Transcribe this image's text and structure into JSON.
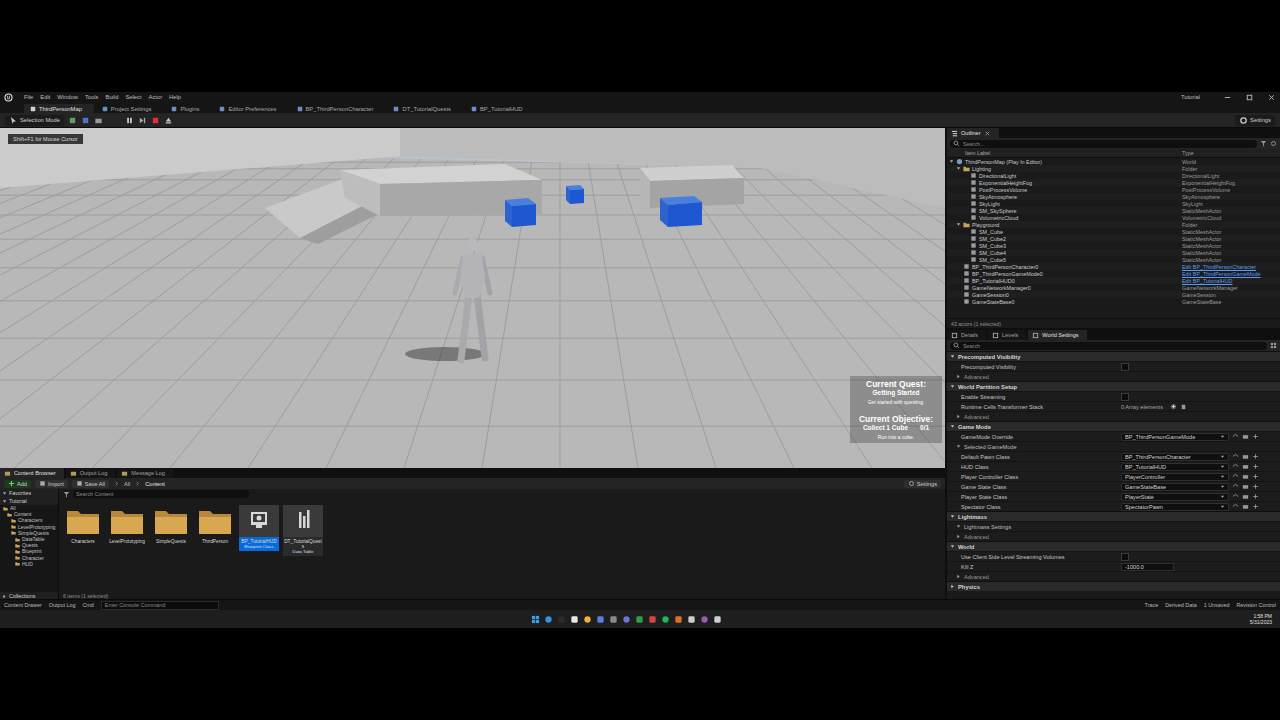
{
  "window": {
    "title": "Tutorial",
    "menu": [
      "File",
      "Edit",
      "Window",
      "Tools",
      "Build",
      "Select",
      "Actor",
      "Help"
    ]
  },
  "tabs": [
    {
      "label": "ThirdPersonMap",
      "selected": true
    },
    {
      "label": "Project Settings",
      "selected": false
    },
    {
      "label": "Plugins",
      "selected": false
    },
    {
      "label": "Editor Preferences",
      "selected": false
    },
    {
      "label": "BP_ThirdPersonCharacter",
      "selected": false
    },
    {
      "label": "DT_TutorialQuests",
      "selected": false
    },
    {
      "label": "BP_TutorialHUD",
      "selected": false
    }
  ],
  "toolbar": {
    "mode": "Selection Mode",
    "settings": "Settings",
    "play_session": {
      "running": true
    }
  },
  "viewport": {
    "hint": "Shift+F1 for Mouse Cursor",
    "quest": {
      "heading": "Current Quest:",
      "name": "Getting Started",
      "description": "Get started with questing."
    },
    "objective": {
      "heading": "Current Objective:",
      "name": "Collect 1 Cube",
      "progress": "0/1",
      "description": "Run into a cube."
    }
  },
  "outliner": {
    "title": "Outliner",
    "search": {
      "placeholder": "Search..."
    },
    "columns": [
      "Item Label",
      "Type"
    ],
    "tree": [
      {
        "label": "ThirdPersonMap (Play In Editor)",
        "type": "World",
        "kind": "world",
        "expanded": true,
        "children": [
          {
            "label": "Lighting",
            "type": "Folder",
            "kind": "folder",
            "expanded": true,
            "children": [
              {
                "label": "DirectionalLight",
                "type": "DirectionalLight",
                "kind": "actor",
                "link": false
              },
              {
                "label": "ExponentialHeightFog",
                "type": "ExponentialHeightFog",
                "kind": "actor",
                "link": false
              },
              {
                "label": "PostProcessVolume",
                "type": "PostProcessVolume",
                "kind": "actor",
                "link": false
              },
              {
                "label": "SkyAtmosphere",
                "type": "SkyAtmosphere",
                "kind": "actor",
                "link": false
              },
              {
                "label": "SkyLight",
                "type": "SkyLight",
                "kind": "actor",
                "link": false
              },
              {
                "label": "SM_SkySphere",
                "type": "StaticMeshActor",
                "kind": "actor",
                "link": false
              },
              {
                "label": "VolumetricCloud",
                "type": "VolumetricCloud",
                "kind": "actor",
                "link": false
              }
            ]
          },
          {
            "label": "Playground",
            "type": "Folder",
            "kind": "folder",
            "expanded": true,
            "children": [
              {
                "label": "SM_Cube",
                "type": "StaticMeshActor",
                "kind": "actor",
                "link": false
              },
              {
                "label": "SM_Cube2",
                "type": "StaticMeshActor",
                "kind": "actor",
                "link": false
              },
              {
                "label": "SM_Cube3",
                "type": "StaticMeshActor",
                "kind": "actor",
                "link": false
              },
              {
                "label": "SM_Cube4",
                "type": "StaticMeshActor",
                "kind": "actor",
                "link": false
              },
              {
                "label": "SM_Cube5",
                "type": "StaticMeshActor",
                "kind": "actor",
                "link": false
              }
            ]
          },
          {
            "label": "BP_ThirdPersonCharacter0",
            "type": "Edit BP_ThirdPersonCharacter",
            "kind": "actor",
            "link": true
          },
          {
            "label": "BP_ThirdPersonGameMode0",
            "type": "Edit BP_ThirdPersonGameMode",
            "kind": "actor",
            "link": true
          },
          {
            "label": "BP_TutorialHUD0",
            "type": "Edit BP_TutorialHUD",
            "kind": "actor",
            "link": true
          },
          {
            "label": "GameNetworkManager0",
            "type": "GameNetworkManager",
            "kind": "actor",
            "link": false
          },
          {
            "label": "GameSession0",
            "type": "GameSession",
            "kind": "actor",
            "link": false
          },
          {
            "label": "GameStateBase0",
            "type": "GameStateBase",
            "kind": "actor",
            "link": false
          }
        ]
      }
    ],
    "footer": "43 actors (1 selected)"
  },
  "details": {
    "tabs": [
      {
        "label": "Details",
        "selected": false
      },
      {
        "label": "Levels",
        "selected": false
      },
      {
        "label": "World Settings",
        "selected": true
      }
    ],
    "search": {
      "placeholder": "Search"
    },
    "sections": [
      {
        "title": "Precomputed Visibility",
        "expanded": true,
        "rows": [
          {
            "kind": "checkbox",
            "label": "Precomputed Visibility",
            "checked": false
          },
          {
            "kind": "advanced",
            "label": "Advanced"
          }
        ]
      },
      {
        "title": "World Partition Setup",
        "expanded": true,
        "rows": [
          {
            "kind": "checkbox",
            "label": "Enable Streaming",
            "checked": false
          },
          {
            "kind": "array",
            "label": "Runtime Cells Transformer Stack",
            "value": "0 Array elements"
          },
          {
            "kind": "advanced",
            "label": "Advanced"
          }
        ]
      },
      {
        "title": "Game Mode",
        "expanded": true,
        "rows": [
          {
            "kind": "dropdown",
            "label": "GameMode Override",
            "value": "BP_ThirdPersonGameMode"
          },
          {
            "kind": "group",
            "label": "Selected GameMode"
          },
          {
            "kind": "dropdown",
            "label": "Default Pawn Class",
            "value": "BP_ThirdPersonCharacter"
          },
          {
            "kind": "dropdown",
            "label": "HUD Class",
            "value": "BP_TutorialHUD"
          },
          {
            "kind": "dropdown",
            "label": "Player Controller Class",
            "value": "PlayerController"
          },
          {
            "kind": "dropdown",
            "label": "Game State Class",
            "value": "GameStateBase"
          },
          {
            "kind": "dropdown",
            "label": "Player State Class",
            "value": "PlayerState"
          },
          {
            "kind": "dropdown",
            "label": "Spectator Class",
            "value": "SpectatorPawn"
          }
        ]
      },
      {
        "title": "Lightmass",
        "expanded": true,
        "rows": [
          {
            "kind": "group",
            "label": "Lightmass Settings"
          },
          {
            "kind": "advanced",
            "label": "Advanced"
          }
        ]
      },
      {
        "title": "World",
        "expanded": true,
        "rows": [
          {
            "kind": "checkbox",
            "label": "Use Client Side Level Streaming Volumes",
            "checked": false
          },
          {
            "kind": "text",
            "label": "Kill Z",
            "value": "-1000.0"
          },
          {
            "kind": "advanced",
            "label": "Advanced"
          }
        ]
      },
      {
        "title": "Physics",
        "expanded": false,
        "rows": []
      }
    ]
  },
  "content_browser": {
    "tabs": [
      {
        "label": "Content Browser",
        "selected": true
      },
      {
        "label": "Output Log",
        "selected": false
      },
      {
        "label": "Message Log",
        "selected": false
      }
    ],
    "buttons": [
      "Add",
      "Import",
      "Save All"
    ],
    "path": [
      "All",
      "Content"
    ],
    "settings": "Settings",
    "search": {
      "placeholder": "Search Content"
    },
    "sidebar": {
      "sections": [
        "Favorites",
        "Tutorial"
      ],
      "tree": [
        {
          "label": "All",
          "depth": 0
        },
        {
          "label": "Content",
          "depth": 1
        },
        {
          "label": "Characters",
          "depth": 2
        },
        {
          "label": "LevelPrototyping",
          "depth": 2
        },
        {
          "label": "SimpleQuests",
          "depth": 2
        },
        {
          "label": "DataTable",
          "depth": 3
        },
        {
          "label": "Quests",
          "depth": 3
        },
        {
          "label": "Blueprint",
          "depth": 3
        },
        {
          "label": "Character",
          "depth": 3
        },
        {
          "label": "HUD",
          "depth": 3
        }
      ],
      "collections": "Collections"
    },
    "items": [
      {
        "name": "Characters",
        "kind": "folder",
        "selected": false,
        "subtitle": ""
      },
      {
        "name": "LevelPrototyping",
        "kind": "folder",
        "selected": false,
        "subtitle": ""
      },
      {
        "name": "SimpleQuests",
        "kind": "folder",
        "selected": false,
        "subtitle": ""
      },
      {
        "name": "ThirdPerson",
        "kind": "folder",
        "selected": false,
        "subtitle": ""
      },
      {
        "name": "BP_TutorialHUD",
        "kind": "blueprint",
        "selected": true,
        "subtitle": "Blueprint Class"
      },
      {
        "name": "DT_TutorialQuests",
        "kind": "datatable",
        "selected": false,
        "subtitle": "Data Table"
      }
    ],
    "footer": "6 items (1 selected)"
  },
  "status_bar": {
    "left": [
      "Content Drawer",
      "Output Log",
      "Cmd"
    ],
    "console": {
      "placeholder": "Enter Console Command"
    },
    "right": [
      "Trace",
      "Derived Data",
      "1 Unsaved",
      "Revision Control"
    ]
  },
  "taskbar": {
    "time": "1:58 PM",
    "date": "5/31/2023"
  }
}
